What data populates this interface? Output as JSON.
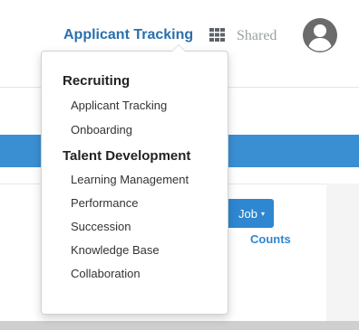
{
  "header": {
    "app_title": "Applicant Tracking",
    "shared_label": "Shared",
    "grid_icon": "grid-icon",
    "avatar_icon": "user-circle-icon"
  },
  "content": {
    "job_button_label": "Job",
    "job_button_caret": "▾",
    "counts_link": "Counts"
  },
  "menu": {
    "sections": [
      {
        "heading": "Recruiting",
        "items": [
          "Applicant Tracking",
          "Onboarding"
        ]
      },
      {
        "heading": "Talent Development",
        "items": [
          "Learning Management",
          "Performance",
          "Succession",
          "Knowledge Base",
          "Collaboration"
        ]
      }
    ]
  },
  "colors": {
    "accent_blue": "#2a6fad",
    "button_blue": "#2e87d0",
    "bar_blue": "#3a8fd3",
    "muted_gray": "#9aa0a4"
  }
}
